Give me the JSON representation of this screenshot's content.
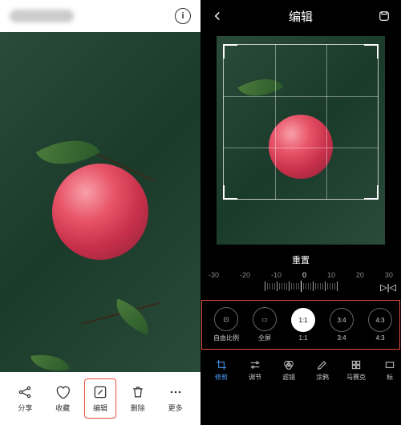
{
  "left": {
    "actions": {
      "share": "分享",
      "favorite": "收藏",
      "edit": "编辑",
      "delete": "删除",
      "more": "更多"
    }
  },
  "right": {
    "title": "编辑",
    "reset": "重置",
    "ruler": {
      "marks": [
        "-30",
        "-20",
        "-10",
        "0",
        "10",
        "20",
        "30"
      ]
    },
    "ratios": {
      "free": {
        "icon": "⊡",
        "label": "自由比例"
      },
      "full": {
        "icon": "▭",
        "label": "全屏"
      },
      "r11": {
        "icon": "1:1",
        "label": "1:1"
      },
      "r34": {
        "icon": "3:4",
        "label": "3:4"
      },
      "r43": {
        "icon": "4:3",
        "label": "4:3"
      }
    },
    "tools": {
      "crop": "修剪",
      "adjust": "调节",
      "filter": "滤镜",
      "doodle": "涂鸦",
      "mosaic": "马赛克",
      "label": "标"
    }
  }
}
